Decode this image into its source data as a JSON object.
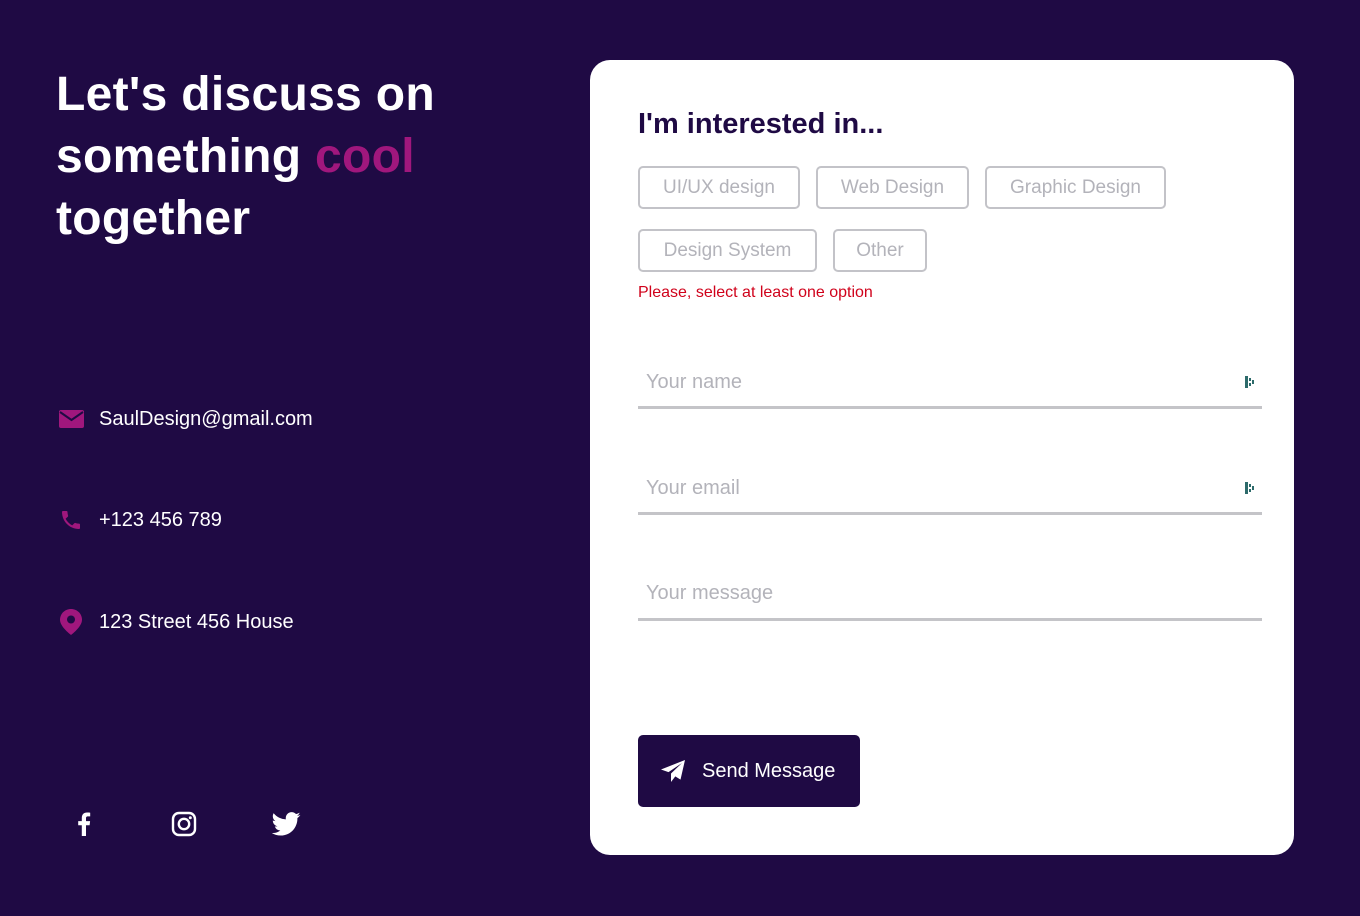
{
  "headline": {
    "line1": "Let's discuss on",
    "line2_prefix": "something ",
    "line2_accent": "cool",
    "line3": "together"
  },
  "contacts": [
    {
      "icon": "mail-icon",
      "text": "SaulDesign@gmail.com"
    },
    {
      "icon": "phone-icon",
      "text": "+123 456 789"
    },
    {
      "icon": "location-pin-icon",
      "text": "123 Street 456 House"
    }
  ],
  "socials": [
    {
      "icon": "facebook-icon"
    },
    {
      "icon": "instagram-icon"
    },
    {
      "icon": "twitter-icon"
    }
  ],
  "form": {
    "title": "I'm interested in...",
    "options": [
      "UI/UX design",
      "Web Design",
      "Graphic Design",
      "Design System",
      "Other"
    ],
    "error": "Please, select at least one option",
    "name_placeholder": "Your name",
    "email_placeholder": "Your email",
    "message_placeholder": "Your message",
    "submit_label": "Send Message",
    "submit_icon": "paper-plane-icon"
  },
  "colors": {
    "background": "#1f0a44",
    "accent": "#a0177d",
    "card": "#ffffff",
    "error": "#d0021b",
    "chip_border": "#c3c3c8"
  }
}
